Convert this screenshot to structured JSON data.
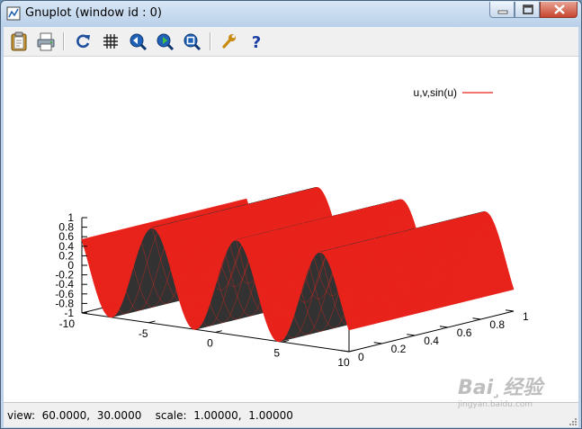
{
  "window": {
    "title": "Gnuplot (window id : 0)"
  },
  "toolbar": {
    "buttons": [
      {
        "name": "copy-to-clipboard",
        "icon": "clipboard-icon"
      },
      {
        "name": "print",
        "icon": "printer-icon"
      },
      {
        "name": "replot",
        "icon": "refresh-icon"
      },
      {
        "name": "toggle-grid",
        "icon": "grid-icon"
      },
      {
        "name": "previous-zoom",
        "icon": "zoom-back-icon"
      },
      {
        "name": "next-zoom",
        "icon": "zoom-forward-icon"
      },
      {
        "name": "autoscale",
        "icon": "zoom-fit-icon"
      },
      {
        "name": "options",
        "icon": "wrench-icon"
      },
      {
        "name": "help",
        "icon": "question-icon"
      }
    ]
  },
  "chart_data": {
    "type": "surface",
    "legend": {
      "label": "u,v,sin(u)",
      "color": "#e8231b",
      "placement": "top-right"
    },
    "function": "sin(u)",
    "x": {
      "range": [
        -10,
        10
      ],
      "ticks": [
        "-10",
        "-5",
        "0",
        "5",
        "10"
      ]
    },
    "y": {
      "range": [
        0,
        1
      ],
      "ticks": [
        "0",
        "0.2",
        "0.4",
        "0.6",
        "0.8",
        "1"
      ]
    },
    "z": {
      "range": [
        -1,
        1
      ],
      "ticks": [
        "1",
        "0.8",
        "0.6",
        "0.4",
        "0.2",
        "0",
        "-0.2",
        "-0.4",
        "-0.6",
        "-0.8",
        "-1"
      ]
    },
    "colors": {
      "surface_top": "#e8231b",
      "surface_bottom": "#333333"
    },
    "grid": false
  },
  "status": {
    "text": "view:  60.0000,  30.0000    scale:  1.00000,  1.00000"
  },
  "watermark": {
    "big": "Bai¸经验",
    "small": "jingyan.baidu.com"
  }
}
